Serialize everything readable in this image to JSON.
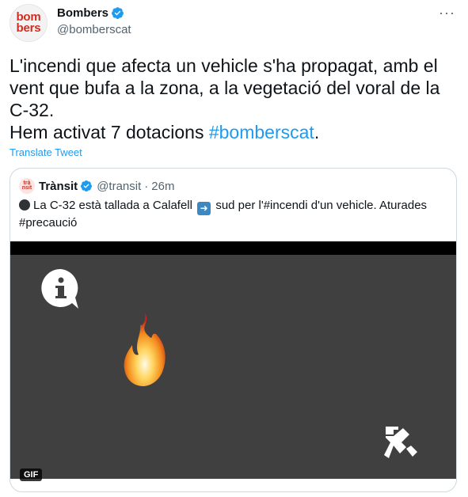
{
  "author": {
    "avatar_text": "bom\nbers",
    "display_name": "Bombers",
    "handle": "@bomberscat"
  },
  "more_icon": "more-dots-icon",
  "tweet": {
    "text_line1": "L'incendi que afecta un vehicle s'ha propagat, amb el vent que bufa a la zona, a la vegetació del voral de la C-32.",
    "text_line2_prefix": "Hem activat 7 dotacions ",
    "hashtag": "#bomberscat",
    "text_line2_suffix": ".",
    "translate_label": "Translate Tweet"
  },
  "quoted": {
    "avatar_text": "trànsit",
    "display_name": "Trànsit",
    "handle": "@transit",
    "separator": "·",
    "time": "26m",
    "text_part1": "La C-32 està tallada a Calafell",
    "text_part2": "sud per l'#incendi d'un vehicle. Aturades #precaució",
    "media_badge": "GIF"
  },
  "colors": {
    "accent": "#1d9bf0",
    "brand_red": "#d52b1e",
    "media_bg": "#404040"
  }
}
